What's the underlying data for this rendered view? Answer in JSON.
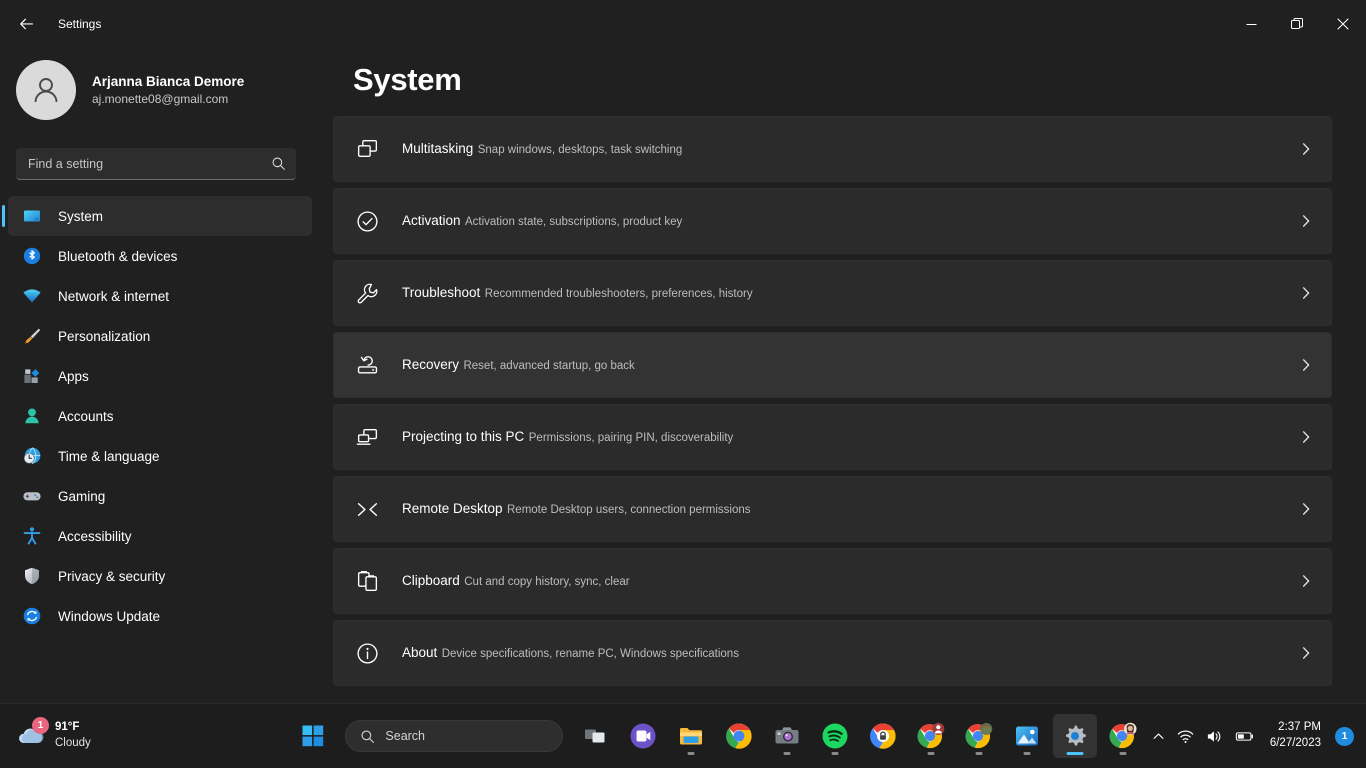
{
  "window": {
    "title": "Settings",
    "back_label": "Back",
    "controls": {
      "minimize": "Minimize",
      "maximize": "Restore",
      "close": "Close"
    }
  },
  "profile": {
    "name": "Arjanna Bianca Demore",
    "email": "aj.monette08@gmail.com"
  },
  "search": {
    "placeholder": "Find a setting",
    "value": ""
  },
  "sidebar": {
    "items": [
      {
        "label": "System",
        "icon": "monitor-icon",
        "active": true
      },
      {
        "label": "Bluetooth & devices",
        "icon": "bluetooth-icon",
        "active": false
      },
      {
        "label": "Network & internet",
        "icon": "wifi-icon",
        "active": false
      },
      {
        "label": "Personalization",
        "icon": "paintbrush-icon",
        "active": false
      },
      {
        "label": "Apps",
        "icon": "apps-icon",
        "active": false
      },
      {
        "label": "Accounts",
        "icon": "account-icon",
        "active": false
      },
      {
        "label": "Time & language",
        "icon": "clock-globe-icon",
        "active": false
      },
      {
        "label": "Gaming",
        "icon": "gamepad-icon",
        "active": false
      },
      {
        "label": "Accessibility",
        "icon": "accessibility-icon",
        "active": false
      },
      {
        "label": "Privacy & security",
        "icon": "shield-icon",
        "active": false
      },
      {
        "label": "Windows Update",
        "icon": "update-icon",
        "active": false
      }
    ]
  },
  "main": {
    "page_title": "System",
    "cards": [
      {
        "title": "Multitasking",
        "subtitle": "Snap windows, desktops, task switching",
        "icon": "windows-overlap-icon",
        "hovered": false
      },
      {
        "title": "Activation",
        "subtitle": "Activation state, subscriptions, product key",
        "icon": "check-circle-icon",
        "hovered": false
      },
      {
        "title": "Troubleshoot",
        "subtitle": "Recommended troubleshooters, preferences, history",
        "icon": "wrench-icon",
        "hovered": false
      },
      {
        "title": "Recovery",
        "subtitle": "Reset, advanced startup, go back",
        "icon": "recovery-icon",
        "hovered": true
      },
      {
        "title": "Projecting to this PC",
        "subtitle": "Permissions, pairing PIN, discoverability",
        "icon": "project-screen-icon",
        "hovered": false
      },
      {
        "title": "Remote Desktop",
        "subtitle": "Remote Desktop users, connection permissions",
        "icon": "remote-desktop-icon",
        "hovered": false
      },
      {
        "title": "Clipboard",
        "subtitle": "Cut and copy history, sync, clear",
        "icon": "clipboard-icon",
        "hovered": false
      },
      {
        "title": "About",
        "subtitle": "Device specifications, rename PC, Windows specifications",
        "icon": "info-circle-icon",
        "hovered": false
      }
    ]
  },
  "taskbar": {
    "weather": {
      "temperature": "91°F",
      "condition": "Cloudy",
      "badge": "1"
    },
    "start_label": "Start",
    "search": {
      "placeholder": "Search"
    },
    "apps": [
      {
        "name": "task-view",
        "label": "Task View",
        "running": false,
        "active": false
      },
      {
        "name": "google-meet",
        "label": "Google Meet",
        "running": false,
        "active": false
      },
      {
        "name": "file-explorer",
        "label": "File Explorer",
        "running": true,
        "active": false
      },
      {
        "name": "google-chrome",
        "label": "Google Chrome",
        "running": false,
        "active": false
      },
      {
        "name": "camera",
        "label": "Camera",
        "running": true,
        "active": false
      },
      {
        "name": "spotify",
        "label": "Spotify",
        "running": true,
        "active": false
      },
      {
        "name": "chrome-password",
        "label": "Chrome Password Manager",
        "running": false,
        "active": false
      },
      {
        "name": "chrome-profile-1",
        "label": "Chrome Profile",
        "running": true,
        "active": false
      },
      {
        "name": "chrome-profile-2",
        "label": "Chrome Profile",
        "running": true,
        "active": false
      },
      {
        "name": "photos",
        "label": "Photos",
        "running": true,
        "active": false
      },
      {
        "name": "settings",
        "label": "Settings",
        "running": true,
        "active": true
      },
      {
        "name": "chrome-profile-3",
        "label": "Chrome Profile",
        "running": true,
        "active": false
      }
    ],
    "tray": {
      "overflow_label": "Show hidden icons",
      "wifi_label": "Network",
      "volume_label": "Volume",
      "battery_label": "Battery",
      "time": "2:37 PM",
      "date": "6/27/2023",
      "notification_count": "1"
    }
  },
  "colors": {
    "accent": "#4cc2ff",
    "window_bg": "#202020",
    "card_bg": "#2b2b2b",
    "card_hover": "#333333",
    "taskbar_bg": "#1d1d1d",
    "badge_red": "#e8667e",
    "badge_blue": "#1f8ce0"
  }
}
